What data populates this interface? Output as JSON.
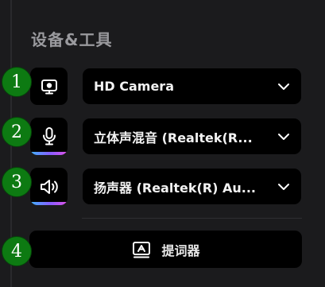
{
  "section": {
    "title": "设备&工具"
  },
  "devices": [
    {
      "icon": "monitor-icon",
      "value": "HD Camera"
    },
    {
      "icon": "microphone-icon",
      "value": "立体声混音 (Realtek(R..."
    },
    {
      "icon": "speaker-icon",
      "value": "扬声器 (Realtek(R) Au..."
    }
  ],
  "teleprompter": {
    "icon": "teleprompter-icon",
    "label": "提词器"
  },
  "markers": [
    "1",
    "2",
    "3",
    "4"
  ],
  "colors": {
    "background": "#1b1b1d",
    "panel": "#000000",
    "marker": "#0d7a12",
    "gradient_start": "#3fb4ff",
    "gradient_end": "#e153e6"
  }
}
